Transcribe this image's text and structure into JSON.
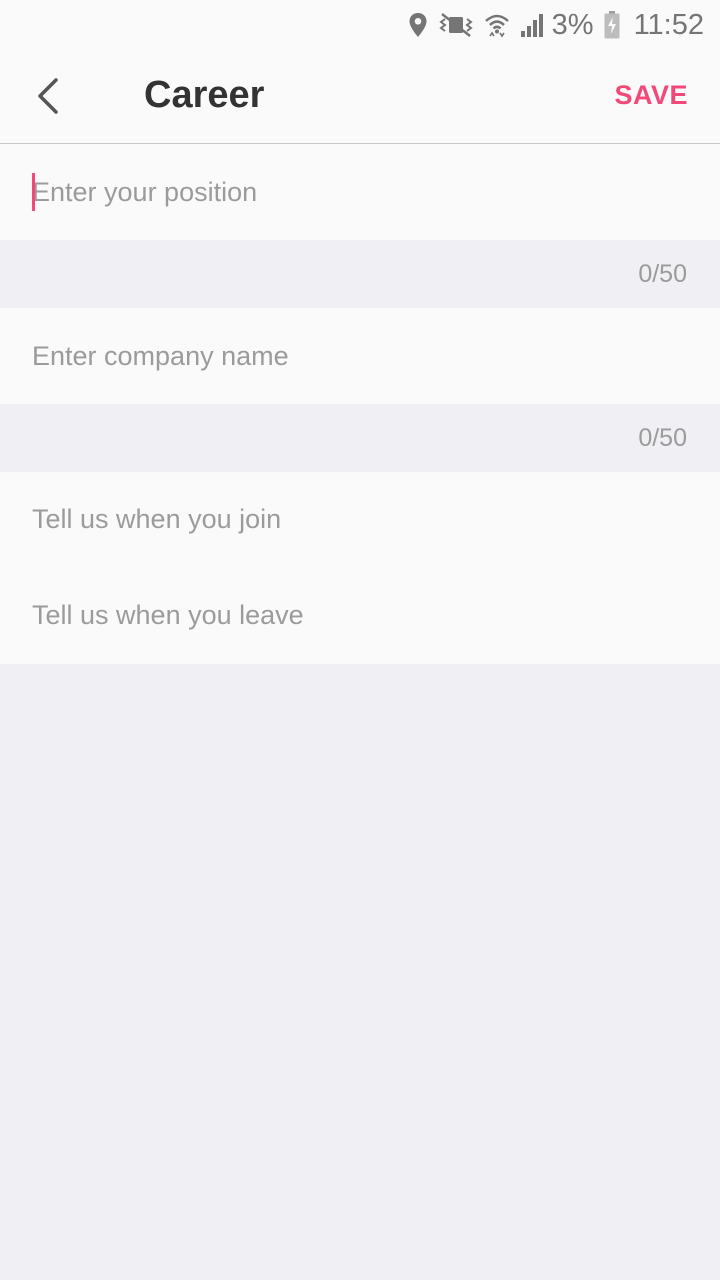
{
  "status_bar": {
    "battery_percent": "3%",
    "time": "11:52"
  },
  "app_bar": {
    "title": "Career",
    "save_label": "SAVE"
  },
  "form": {
    "position": {
      "value": "",
      "placeholder": "Enter your position",
      "counter": "0/50"
    },
    "company": {
      "value": "",
      "placeholder": "Enter company name",
      "counter": "0/50"
    },
    "join_date": {
      "placeholder": "Tell us when you join"
    },
    "leave_date": {
      "placeholder": "Tell us when you leave"
    }
  },
  "colors": {
    "accent": "#f24a78",
    "background": "#efeff4",
    "surface": "#fafafa",
    "placeholder": "#9b9b9b"
  }
}
